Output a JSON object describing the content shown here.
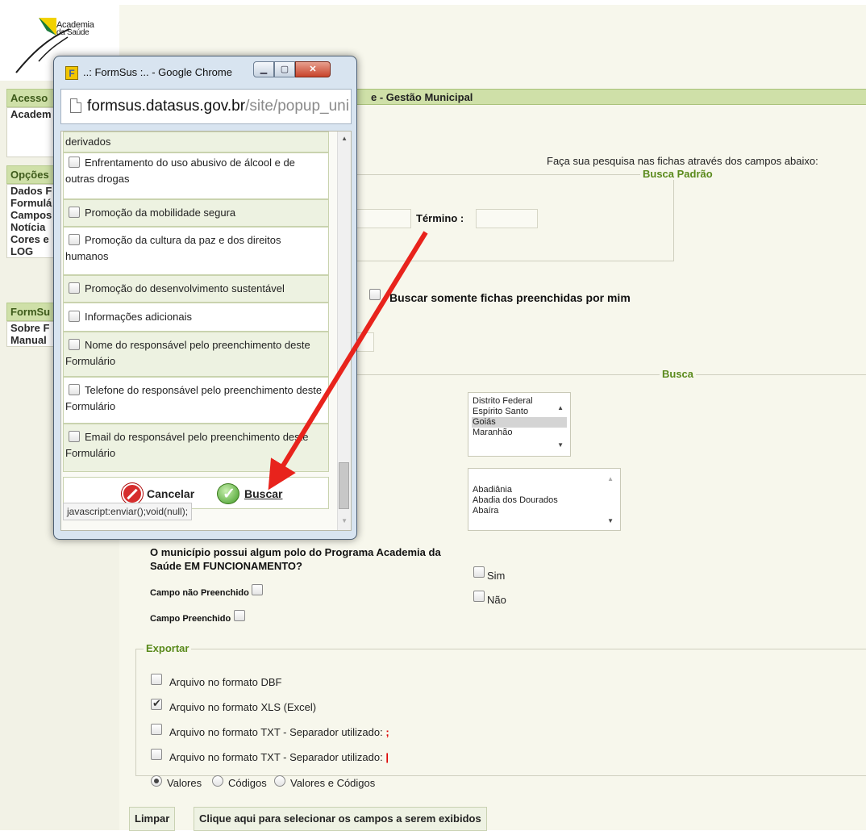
{
  "logo": {
    "line1": "Academia",
    "line2": "da Saúde"
  },
  "sidebar": {
    "access_head": "Acesso",
    "access_item": "Academ",
    "options_head": "Opções",
    "options_items": [
      "Dados F",
      "Formulá",
      "Campos",
      "Notícia",
      "Cores e",
      "LOG"
    ],
    "formsus_head": "FormSu",
    "formsus_items": [
      "Sobre F",
      "Manual"
    ]
  },
  "main": {
    "header_title": "e - Gestão Municipal",
    "search_hint": "Faça sua pesquisa nas fichas através dos campos abaixo:",
    "busca_padrao_legend": "Busca Padrão",
    "termino_label": "Término :",
    "only_mine_label": "Buscar somente fichas preenchidas por mim",
    "busca_legend": "Busca",
    "states": [
      "Distrito Federal",
      "Espírito Santo",
      "Goiás",
      "Maranhão"
    ],
    "selected_state": "Goiás",
    "municipalities": [
      "Abadiânia",
      "Abadia dos Dourados",
      "Abaíra"
    ],
    "question_line1": "O município possui algum polo do Programa Academia da",
    "question_line2": "Saúde EM FUNCIONAMENTO?",
    "campo_nao_preenchido": "Campo não Preenchido",
    "campo_preenchido": "Campo Preenchido",
    "sim_label": "Sim",
    "nao_label": "Não",
    "export_legend": "Exportar",
    "export_dbf": "Arquivo no formato DBF",
    "export_xls": "Arquivo no formato XLS (Excel)",
    "export_txt_1": "Arquivo no formato TXT - Separador utilizado:",
    "export_txt_1_sep": ";",
    "export_txt_2": "Arquivo no formato TXT - Separador utilizado:",
    "export_txt_2_sep": "|",
    "radio_valores": "Valores",
    "radio_codigos": "Códigos",
    "radio_valores_codigos": "Valores e Códigos",
    "btn_limpar": "Limpar",
    "btn_select_fields": "Clique aqui para selecionar os campos a serem exibidos"
  },
  "popup": {
    "title": "..: FormSus :.. - Google Chrome",
    "favicon": "F",
    "url_host": "formsus.datasus.gov.br",
    "url_path": "/site/popup_uni",
    "rows": [
      {
        "line1": "derivados"
      },
      {
        "line1": "Enfrentamento do uso abusivo de álcool e de",
        "line2": "outras drogas"
      },
      {
        "line1": "Promoção da mobilidade segura"
      },
      {
        "line1": "Promoção da cultura da paz e dos direitos",
        "line2": "humanos"
      },
      {
        "line1": "Promoção do desenvolvimento sustentável"
      },
      {
        "line1": "Informações adicionais"
      },
      {
        "line1": "Nome do responsável pelo preenchimento deste",
        "line2": "Formulário"
      },
      {
        "line1": "Telefone do responsável pelo preenchimento deste",
        "line2": "Formulário"
      },
      {
        "line1": "Email do responsável pelo preenchimento deste",
        "line2": "Formulário"
      }
    ],
    "cancel_label": "Cancelar",
    "search_label": "Buscar",
    "status_text": "javascript:enviar();void(null);"
  },
  "colors": {
    "accent_green": "#5a8a1c",
    "header_green": "#cfe0a8",
    "annotation_red": "#e8231c"
  }
}
